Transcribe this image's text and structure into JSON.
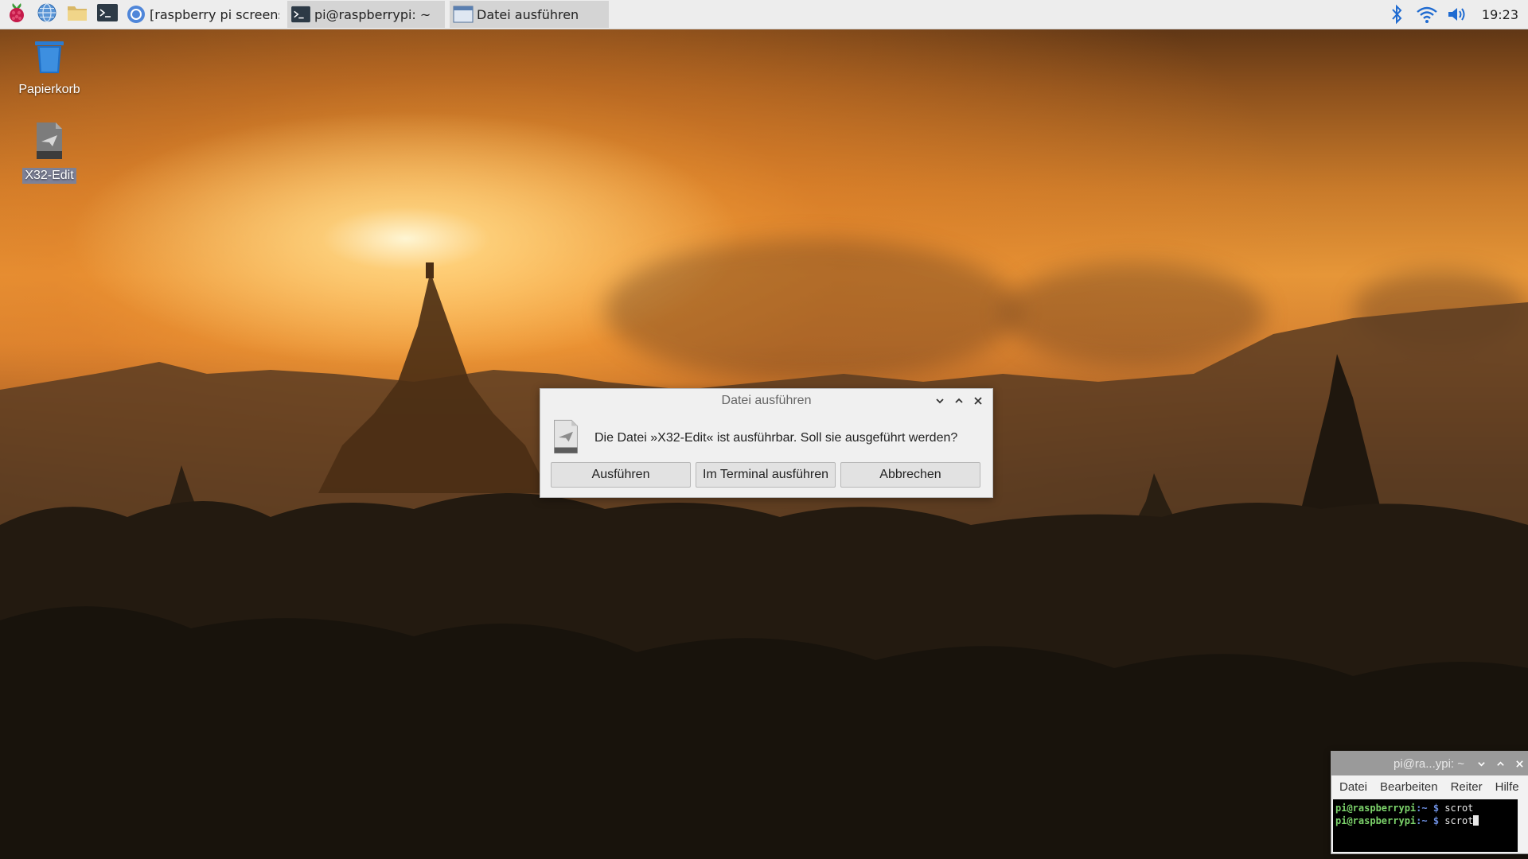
{
  "taskbar": {
    "launchers": [
      {
        "name": "raspberry-menu",
        "icon": "raspberry-icon"
      },
      {
        "name": "web-browser",
        "icon": "globe-icon"
      },
      {
        "name": "file-manager",
        "icon": "folder-icon"
      },
      {
        "name": "terminal",
        "icon": "terminal-icon"
      }
    ],
    "windows": [
      {
        "label": "[raspberry pi screens...",
        "icon": "chromium-icon",
        "active": false
      },
      {
        "label": "pi@raspberrypi: ~",
        "icon": "terminal-icon",
        "active": true
      },
      {
        "label": "Datei ausführen",
        "icon": "window-icon",
        "active": true
      }
    ],
    "tray": {
      "bluetooth_icon": "bluetooth-icon",
      "wifi_icon": "wifi-icon",
      "volume_icon": "volume-icon",
      "clock": "19:23"
    }
  },
  "desktop": {
    "icons": [
      {
        "label": "Papierkorb",
        "icon": "trash-icon"
      },
      {
        "label": "X32-Edit",
        "icon": "executable-file-icon",
        "selected": true
      }
    ]
  },
  "dialog": {
    "title": "Datei ausführen",
    "message": "Die Datei »X32-Edit« ist ausführbar. Soll sie ausgeführt werden?",
    "buttons": {
      "run": "Ausführen",
      "run_in_terminal": "Im Terminal ausführen",
      "cancel": "Abbrechen"
    }
  },
  "terminal": {
    "title": "pi@ra...ypi: ~",
    "menu": [
      "Datei",
      "Bearbeiten",
      "Reiter",
      "Hilfe"
    ],
    "lines": [
      {
        "user": "pi@raspberrypi",
        "path": ":~ $",
        "cmd": " scrot"
      },
      {
        "user": "pi@raspberrypi",
        "path": ":~ $",
        "cmd": " scrot"
      }
    ]
  },
  "colors": {
    "taskbar_bg": "#ededed",
    "dialog_bg": "#f0f0f0",
    "terminal_titlebar": "#9a9a9a",
    "prompt_green": "#7cd36b",
    "prompt_blue": "#6d8fe0"
  }
}
